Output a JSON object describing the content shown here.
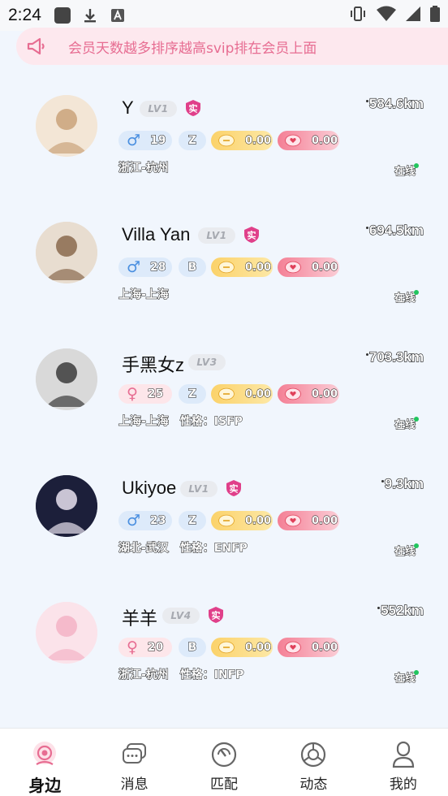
{
  "status_bar": {
    "time": "2:24"
  },
  "notice": {
    "text": "会员天数越多排序越高svip排在会员上面"
  },
  "users": [
    {
      "name": "Y",
      "level": "LV1",
      "verified": "实",
      "distance": "584.6km",
      "gender": "male",
      "gender_symbol": "♂",
      "age": "19",
      "tag": "Z",
      "coins": "0.00",
      "hearts": "0.00",
      "location": "浙江-杭州",
      "personality": "",
      "status": "在线"
    },
    {
      "name": "Villa Yan",
      "level": "LV1",
      "verified": "实",
      "distance": "694.5km",
      "gender": "male",
      "gender_symbol": "♂",
      "age": "28",
      "tag": "B",
      "coins": "0.00",
      "hearts": "0.00",
      "location": "上海-上海",
      "personality": "",
      "status": "在线"
    },
    {
      "name": "手黑女z",
      "level": "LV3",
      "verified": "",
      "distance": "703.3km",
      "gender": "female",
      "gender_symbol": "♀",
      "age": "25",
      "tag": "Z",
      "coins": "0.00",
      "hearts": "0.00",
      "location": "上海-上海",
      "personality": "性格：ISFP",
      "status": "在线"
    },
    {
      "name": "Ukiyoe",
      "level": "LV1",
      "verified": "实",
      "distance": "9.3km",
      "gender": "male",
      "gender_symbol": "♂",
      "age": "23",
      "tag": "Z",
      "coins": "0.00",
      "hearts": "0.00",
      "location": "湖北-武汉",
      "personality": "性格：ENFP",
      "status": "在线"
    },
    {
      "name": "羊羊",
      "level": "LV4",
      "verified": "实",
      "distance": "552km",
      "gender": "female",
      "gender_symbol": "♀",
      "age": "20",
      "tag": "B",
      "coins": "0.00",
      "hearts": "0.00",
      "location": "浙江-杭州",
      "personality": "性格：INFP",
      "status": "在线"
    }
  ],
  "tabs": [
    {
      "label": "身边",
      "icon": "nearby-icon",
      "active": true
    },
    {
      "label": "消息",
      "icon": "message-icon",
      "active": false
    },
    {
      "label": "匹配",
      "icon": "match-icon",
      "active": false
    },
    {
      "label": "动态",
      "icon": "moments-icon",
      "active": false
    },
    {
      "label": "我的",
      "icon": "profile-icon",
      "active": false
    }
  ],
  "colors": {
    "accent": "#e76d92",
    "online": "#22c55e",
    "notice_bg": "#fde8ee",
    "page_bg": "#f1f6fd"
  }
}
